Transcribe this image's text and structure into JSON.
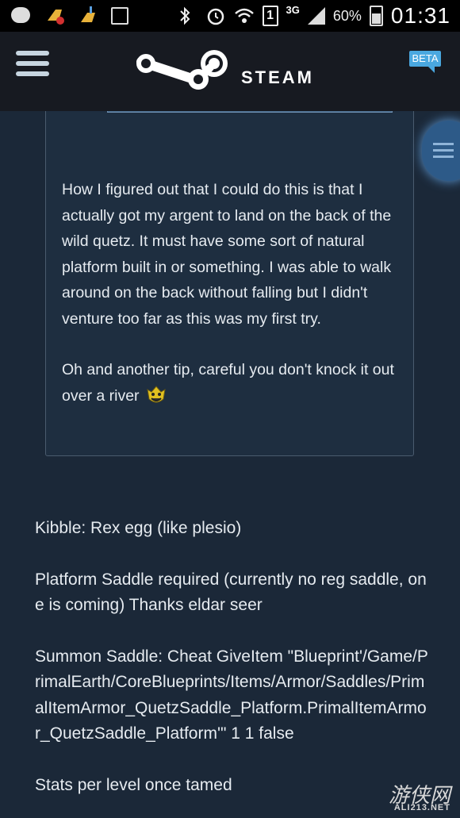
{
  "statusbar": {
    "battery_percent": "60%",
    "time": "01:31",
    "network": "3G",
    "sim": "1"
  },
  "header": {
    "brand": "STEAM",
    "badge": "BETA"
  },
  "quote": {
    "paragraphs": [
      "How I figured out that I could do this is that I actually got my argent to land on the back of the wild quetz. It must have some sort of natural platform built in or something. I was able to walk around on the back without falling but I didn't venture too far as this was my first try.",
      "Oh and another tip, careful you don't knock it out over a river"
    ],
    "emote_icon": "goblin-face-emote-icon"
  },
  "body": {
    "paragraphs": [
      "Kibble: Rex egg (like plesio)",
      "Platform Saddle required (currently no reg saddle, one is coming) Thanks eldar seer",
      "Summon Saddle: Cheat GiveItem \"Blueprint'/Game/PrimalEarth/CoreBlueprints/Items/Armor/Saddles/PrimalItemArmor_QuetzSaddle_Platform.PrimalItemArmor_QuetzSaddle_Platform'\" 1 1 false",
      "Stats per level once tamed"
    ]
  },
  "watermark": {
    "main": "游侠网",
    "sub": "ALI213.NET"
  },
  "colors": {
    "background": "#1b2838",
    "header": "#171a21",
    "accent": "#4aa8e0"
  }
}
